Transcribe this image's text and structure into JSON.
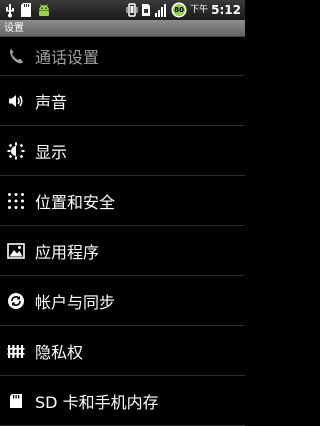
{
  "status_bar": {
    "battery_level": "80",
    "ampm": "下午",
    "time": "5:12",
    "icons": [
      "usb-icon",
      "sd-card-icon",
      "android-debug-icon",
      "vibrate-icon",
      "sim-icon",
      "signal-icon",
      "battery-icon"
    ]
  },
  "title_bar": {
    "title": "设置"
  },
  "settings": {
    "items": [
      {
        "label": "通话设置",
        "icon": "phone-icon"
      },
      {
        "label": "声音",
        "icon": "speaker-icon"
      },
      {
        "label": "显示",
        "icon": "brightness-icon"
      },
      {
        "label": "位置和安全",
        "icon": "dot-grid-icon"
      },
      {
        "label": "应用程序",
        "icon": "image-icon"
      },
      {
        "label": "帐户与同步",
        "icon": "sync-icon"
      },
      {
        "label": "隐私权",
        "icon": "privacy-icon"
      },
      {
        "label": "SD 卡和手机内存",
        "icon": "storage-icon"
      }
    ]
  },
  "colors": {
    "background": "#000000",
    "title_bar": "#7a7a7a",
    "divider": "#2c2c2c",
    "battery_fill": "#8fd14f"
  }
}
